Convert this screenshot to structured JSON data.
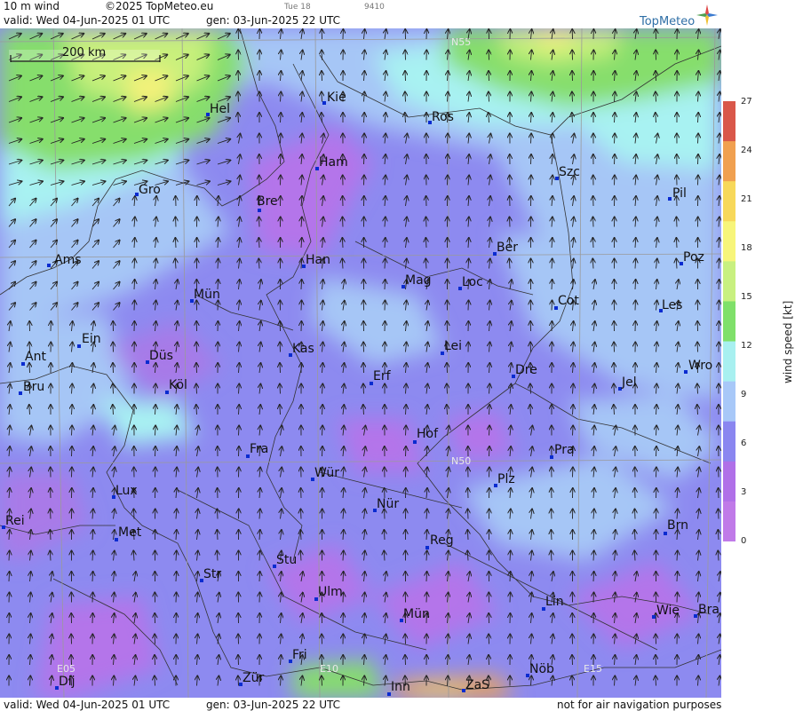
{
  "header": {
    "product": "10 m wind",
    "copyright": "©2025 TopMeteo.eu",
    "small_day": "Tue 18",
    "small_code": "9410",
    "valid": "valid:  Wed  04-Jun-2025  01 UTC",
    "generated": "gen: 03-Jun-2025 22 UTC",
    "logo": "TopMeteo"
  },
  "footer": {
    "valid": "valid:  Wed  04-Jun-2025  01 UTC",
    "generated": "gen: 03-Jun-2025 22 UTC",
    "disclaimer": "not for air navigation purposes"
  },
  "scale_bar": "200 km",
  "legend": {
    "title": "wind speed [kt]",
    "ticks": [
      "27",
      "24",
      "21",
      "18",
      "15",
      "12",
      "9",
      "6",
      "3",
      "0"
    ],
    "colors": [
      "#d9574a",
      "#f0a050",
      "#f7d85a",
      "#f7f57a",
      "#c8f080",
      "#7fe06a",
      "#a8f0f0",
      "#a8c8f8",
      "#8a86f0",
      "#b070e8",
      "#c07ae8"
    ]
  },
  "grid_labels": [
    "N55",
    "N50",
    "E05",
    "E10",
    "E15"
  ],
  "cities": [
    {
      "name": "Kie"
    },
    {
      "name": "Hel"
    },
    {
      "name": "Ros"
    },
    {
      "name": "Ham"
    },
    {
      "name": "Szc"
    },
    {
      "name": "Gro"
    },
    {
      "name": "Bre"
    },
    {
      "name": "Pil"
    },
    {
      "name": "Ber"
    },
    {
      "name": "Ams"
    },
    {
      "name": "Han"
    },
    {
      "name": "Poz"
    },
    {
      "name": "Mag"
    },
    {
      "name": "Loc"
    },
    {
      "name": "Mün"
    },
    {
      "name": "Cot"
    },
    {
      "name": "Les"
    },
    {
      "name": "Ein"
    },
    {
      "name": "Kas"
    },
    {
      "name": "Lei"
    },
    {
      "name": "Ant"
    },
    {
      "name": "Düs"
    },
    {
      "name": "Dre"
    },
    {
      "name": "Wro"
    },
    {
      "name": "Erf"
    },
    {
      "name": "Köl"
    },
    {
      "name": "Jel"
    },
    {
      "name": "Bru"
    },
    {
      "name": "Hof"
    },
    {
      "name": "Fra"
    },
    {
      "name": "Pra"
    },
    {
      "name": "Wür"
    },
    {
      "name": "Plz"
    },
    {
      "name": "Lux"
    },
    {
      "name": "Nür"
    },
    {
      "name": "Rei"
    },
    {
      "name": "Met"
    },
    {
      "name": "Brn"
    },
    {
      "name": "Reg"
    },
    {
      "name": "Stu"
    },
    {
      "name": "Str"
    },
    {
      "name": "Ulm"
    },
    {
      "name": "Lin"
    },
    {
      "name": "Wie"
    },
    {
      "name": "Bra"
    },
    {
      "name": "Mün"
    },
    {
      "name": "Fri"
    },
    {
      "name": "Nöb"
    },
    {
      "name": "Dij"
    },
    {
      "name": "Zür"
    },
    {
      "name": "Inn"
    },
    {
      "name": "ZaS"
    }
  ],
  "wind_direction": "from south to south-west (northward arrows), stronger westerly flow over the North Sea"
}
